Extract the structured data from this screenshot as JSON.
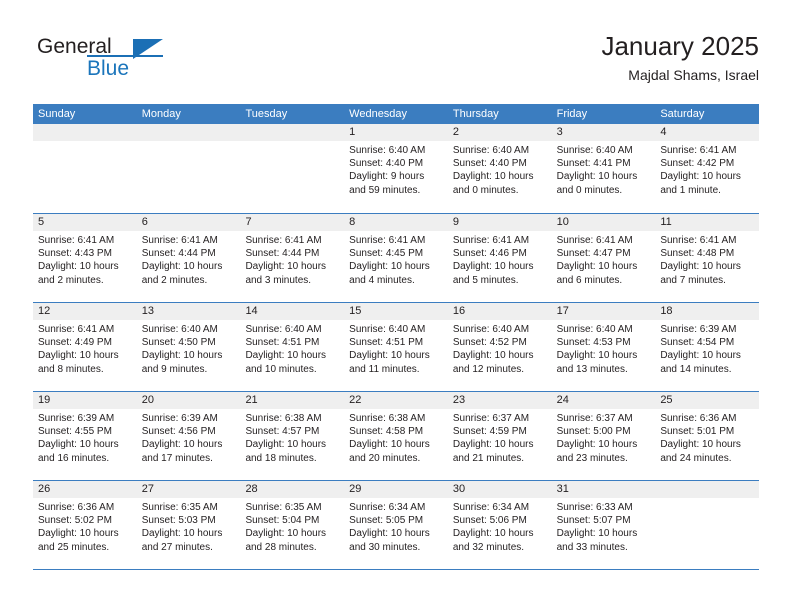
{
  "brand": {
    "name_part1": "General",
    "name_part2": "Blue",
    "triangle_color": "#1b6fb5"
  },
  "header": {
    "title": "January 2025",
    "subtitle": "Majdal Shams, Israel"
  },
  "theme": {
    "header_blue": "#3b7dc0",
    "daynum_strip": "#efefef",
    "text": "#231f20",
    "brand_blue": "#1b75bb"
  },
  "weekdays": [
    "Sunday",
    "Monday",
    "Tuesday",
    "Wednesday",
    "Thursday",
    "Friday",
    "Saturday"
  ],
  "weeks": [
    [
      {
        "day": "",
        "sunrise": "",
        "sunset": "",
        "daylight": "",
        "empty": true
      },
      {
        "day": "",
        "sunrise": "",
        "sunset": "",
        "daylight": "",
        "empty": true
      },
      {
        "day": "",
        "sunrise": "",
        "sunset": "",
        "daylight": "",
        "empty": true
      },
      {
        "day": "1",
        "sunrise": "Sunrise: 6:40 AM",
        "sunset": "Sunset: 4:40 PM",
        "daylight": "Daylight: 9 hours and 59 minutes."
      },
      {
        "day": "2",
        "sunrise": "Sunrise: 6:40 AM",
        "sunset": "Sunset: 4:40 PM",
        "daylight": "Daylight: 10 hours and 0 minutes."
      },
      {
        "day": "3",
        "sunrise": "Sunrise: 6:40 AM",
        "sunset": "Sunset: 4:41 PM",
        "daylight": "Daylight: 10 hours and 0 minutes."
      },
      {
        "day": "4",
        "sunrise": "Sunrise: 6:41 AM",
        "sunset": "Sunset: 4:42 PM",
        "daylight": "Daylight: 10 hours and 1 minute."
      }
    ],
    [
      {
        "day": "5",
        "sunrise": "Sunrise: 6:41 AM",
        "sunset": "Sunset: 4:43 PM",
        "daylight": "Daylight: 10 hours and 2 minutes."
      },
      {
        "day": "6",
        "sunrise": "Sunrise: 6:41 AM",
        "sunset": "Sunset: 4:44 PM",
        "daylight": "Daylight: 10 hours and 2 minutes."
      },
      {
        "day": "7",
        "sunrise": "Sunrise: 6:41 AM",
        "sunset": "Sunset: 4:44 PM",
        "daylight": "Daylight: 10 hours and 3 minutes."
      },
      {
        "day": "8",
        "sunrise": "Sunrise: 6:41 AM",
        "sunset": "Sunset: 4:45 PM",
        "daylight": "Daylight: 10 hours and 4 minutes."
      },
      {
        "day": "9",
        "sunrise": "Sunrise: 6:41 AM",
        "sunset": "Sunset: 4:46 PM",
        "daylight": "Daylight: 10 hours and 5 minutes."
      },
      {
        "day": "10",
        "sunrise": "Sunrise: 6:41 AM",
        "sunset": "Sunset: 4:47 PM",
        "daylight": "Daylight: 10 hours and 6 minutes."
      },
      {
        "day": "11",
        "sunrise": "Sunrise: 6:41 AM",
        "sunset": "Sunset: 4:48 PM",
        "daylight": "Daylight: 10 hours and 7 minutes."
      }
    ],
    [
      {
        "day": "12",
        "sunrise": "Sunrise: 6:41 AM",
        "sunset": "Sunset: 4:49 PM",
        "daylight": "Daylight: 10 hours and 8 minutes."
      },
      {
        "day": "13",
        "sunrise": "Sunrise: 6:40 AM",
        "sunset": "Sunset: 4:50 PM",
        "daylight": "Daylight: 10 hours and 9 minutes."
      },
      {
        "day": "14",
        "sunrise": "Sunrise: 6:40 AM",
        "sunset": "Sunset: 4:51 PM",
        "daylight": "Daylight: 10 hours and 10 minutes."
      },
      {
        "day": "15",
        "sunrise": "Sunrise: 6:40 AM",
        "sunset": "Sunset: 4:51 PM",
        "daylight": "Daylight: 10 hours and 11 minutes."
      },
      {
        "day": "16",
        "sunrise": "Sunrise: 6:40 AM",
        "sunset": "Sunset: 4:52 PM",
        "daylight": "Daylight: 10 hours and 12 minutes."
      },
      {
        "day": "17",
        "sunrise": "Sunrise: 6:40 AM",
        "sunset": "Sunset: 4:53 PM",
        "daylight": "Daylight: 10 hours and 13 minutes."
      },
      {
        "day": "18",
        "sunrise": "Sunrise: 6:39 AM",
        "sunset": "Sunset: 4:54 PM",
        "daylight": "Daylight: 10 hours and 14 minutes."
      }
    ],
    [
      {
        "day": "19",
        "sunrise": "Sunrise: 6:39 AM",
        "sunset": "Sunset: 4:55 PM",
        "daylight": "Daylight: 10 hours and 16 minutes."
      },
      {
        "day": "20",
        "sunrise": "Sunrise: 6:39 AM",
        "sunset": "Sunset: 4:56 PM",
        "daylight": "Daylight: 10 hours and 17 minutes."
      },
      {
        "day": "21",
        "sunrise": "Sunrise: 6:38 AM",
        "sunset": "Sunset: 4:57 PM",
        "daylight": "Daylight: 10 hours and 18 minutes."
      },
      {
        "day": "22",
        "sunrise": "Sunrise: 6:38 AM",
        "sunset": "Sunset: 4:58 PM",
        "daylight": "Daylight: 10 hours and 20 minutes."
      },
      {
        "day": "23",
        "sunrise": "Sunrise: 6:37 AM",
        "sunset": "Sunset: 4:59 PM",
        "daylight": "Daylight: 10 hours and 21 minutes."
      },
      {
        "day": "24",
        "sunrise": "Sunrise: 6:37 AM",
        "sunset": "Sunset: 5:00 PM",
        "daylight": "Daylight: 10 hours and 23 minutes."
      },
      {
        "day": "25",
        "sunrise": "Sunrise: 6:36 AM",
        "sunset": "Sunset: 5:01 PM",
        "daylight": "Daylight: 10 hours and 24 minutes."
      }
    ],
    [
      {
        "day": "26",
        "sunrise": "Sunrise: 6:36 AM",
        "sunset": "Sunset: 5:02 PM",
        "daylight": "Daylight: 10 hours and 25 minutes."
      },
      {
        "day": "27",
        "sunrise": "Sunrise: 6:35 AM",
        "sunset": "Sunset: 5:03 PM",
        "daylight": "Daylight: 10 hours and 27 minutes."
      },
      {
        "day": "28",
        "sunrise": "Sunrise: 6:35 AM",
        "sunset": "Sunset: 5:04 PM",
        "daylight": "Daylight: 10 hours and 28 minutes."
      },
      {
        "day": "29",
        "sunrise": "Sunrise: 6:34 AM",
        "sunset": "Sunset: 5:05 PM",
        "daylight": "Daylight: 10 hours and 30 minutes."
      },
      {
        "day": "30",
        "sunrise": "Sunrise: 6:34 AM",
        "sunset": "Sunset: 5:06 PM",
        "daylight": "Daylight: 10 hours and 32 minutes."
      },
      {
        "day": "31",
        "sunrise": "Sunrise: 6:33 AM",
        "sunset": "Sunset: 5:07 PM",
        "daylight": "Daylight: 10 hours and 33 minutes."
      },
      {
        "day": "",
        "sunrise": "",
        "sunset": "",
        "daylight": "",
        "empty": true
      }
    ]
  ]
}
